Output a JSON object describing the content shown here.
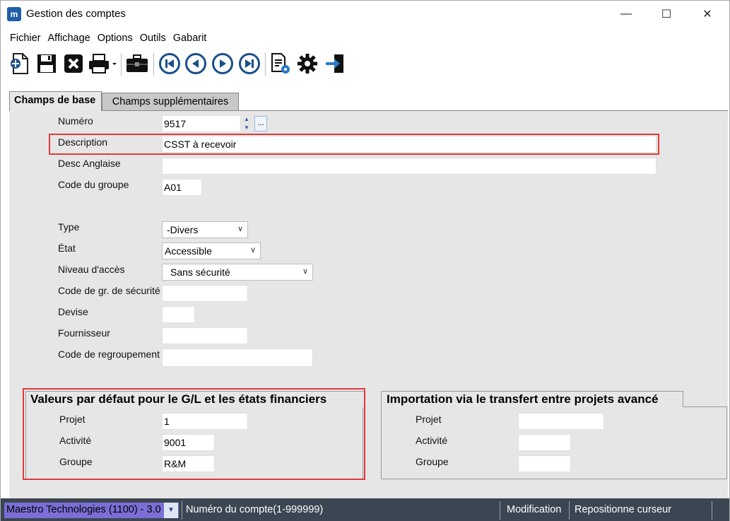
{
  "window": {
    "title": "Gestion des comptes",
    "app_icon": "m",
    "minimize": "—",
    "maximize": "☐",
    "close": "✕"
  },
  "menu": [
    "Fichier",
    "Affichage",
    "Options",
    "Outils",
    "Gabarit"
  ],
  "toolbar": {
    "icons": [
      "new-document-icon",
      "save-icon",
      "delete-icon",
      "print-icon",
      "briefcase-icon",
      "first-record-icon",
      "previous-record-icon",
      "next-record-icon",
      "last-record-icon",
      "document-settings-icon",
      "gear-icon",
      "exit-icon"
    ]
  },
  "tabs": {
    "base": "Champs de base",
    "supplementary": "Champs supplémentaires"
  },
  "form": {
    "numero_label": "Numéro",
    "numero_value": "9517",
    "description_label": "Description",
    "description_value": "CSST à recevoir",
    "desc_anglaise_label": "Desc Anglaise",
    "desc_anglaise_value": "",
    "code_groupe_label": "Code du groupe",
    "code_groupe_value": "A01",
    "type_label": "Type",
    "type_value": "-Divers",
    "etat_label": "État",
    "etat_value": "Accessible",
    "niveau_label": "Niveau d'accès",
    "niveau_value": "Sans sécurité",
    "code_gr_securite_label": "Code de gr. de sécurité",
    "code_gr_securite_value": "",
    "devise_label": "Devise",
    "devise_value": "",
    "fournisseur_label": "Fournisseur",
    "fournisseur_value": "",
    "code_regroupement_label": "Code de regroupement",
    "code_regroupement_value": ""
  },
  "defaults_group": {
    "title": "Valeurs par défaut pour le G/L et les états financiers",
    "projet_label": "Projet",
    "projet_value": "1",
    "activite_label": "Activité",
    "activite_value": "9001",
    "groupe_label": "Groupe",
    "groupe_value": "R&M"
  },
  "import_group": {
    "title": "Importation via le transfert entre projets avancé",
    "projet_label": "Projet",
    "projet_value": "",
    "activite_label": "Activité",
    "activite_value": "",
    "groupe_label": "Groupe",
    "groupe_value": ""
  },
  "statusbar": {
    "company": "Maestro Technologies (1100) - 3.0",
    "hint": "Numéro du compte(1-999999)",
    "mode": "Modification",
    "action": "Repositionne curseur"
  },
  "colors": {
    "highlight": "#e23a3a",
    "status_bg": "#3b4652",
    "company_bg": "#7b6ed6",
    "icon_blue": "#1b4f8a"
  }
}
